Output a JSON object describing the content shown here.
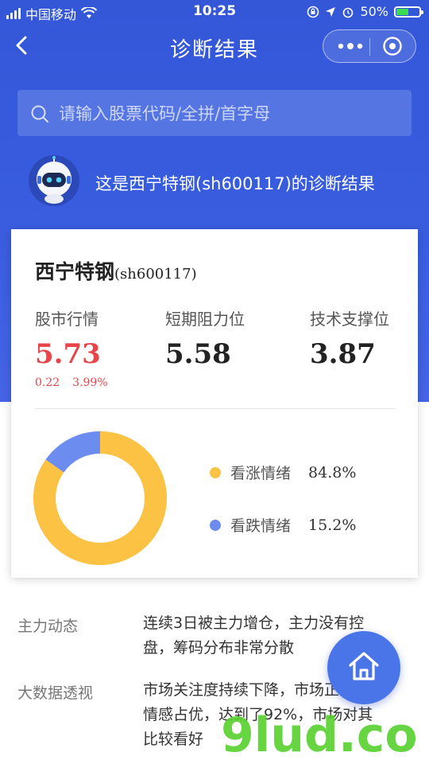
{
  "status_bar": {
    "carrier": "中国移动",
    "time": "10:25",
    "battery": "50%"
  },
  "nav": {
    "title": "诊断结果"
  },
  "search": {
    "placeholder": "请输入股票代码/全拼/首字母"
  },
  "intro": {
    "text": "这是西宁特钢(sh600117)的诊断结果"
  },
  "card": {
    "stock_name": "西宁特钢",
    "stock_code": "(sh600117)",
    "metrics": [
      {
        "label": "股市行情",
        "value": "5.73"
      },
      {
        "label": "短期阻力位",
        "value": "5.58"
      },
      {
        "label": "技术支撑位",
        "value": "3.87"
      }
    ],
    "change": {
      "amount": "0.22",
      "percent": "3.99%"
    }
  },
  "sentiment": {
    "items": [
      {
        "label": "看涨情绪",
        "percent": "84.8%",
        "value": 84.8,
        "color": "#fbc243"
      },
      {
        "label": "看跌情绪",
        "percent": "15.2%",
        "value": 15.2,
        "color": "#6d8cf0"
      }
    ]
  },
  "details": [
    {
      "label": "主力动态",
      "lines": [
        "连续3日被主力增仓，主力没有控",
        "盘，筹码分布非常分散"
      ]
    },
    {
      "label": "大数据透视",
      "lines": [
        "市场关注度持续下降，市场正",
        "情感占优，达到了92%，市场对其",
        "比较看好"
      ]
    }
  ],
  "watermark": {
    "text": "9lud.com"
  },
  "colors": {
    "primary": "#3457d8",
    "up": "#e6454a",
    "bull": "#fbc243",
    "bear": "#6d8cf0"
  },
  "icons": [
    "back-icon",
    "more-icon",
    "target-icon",
    "search-icon",
    "home-icon"
  ]
}
